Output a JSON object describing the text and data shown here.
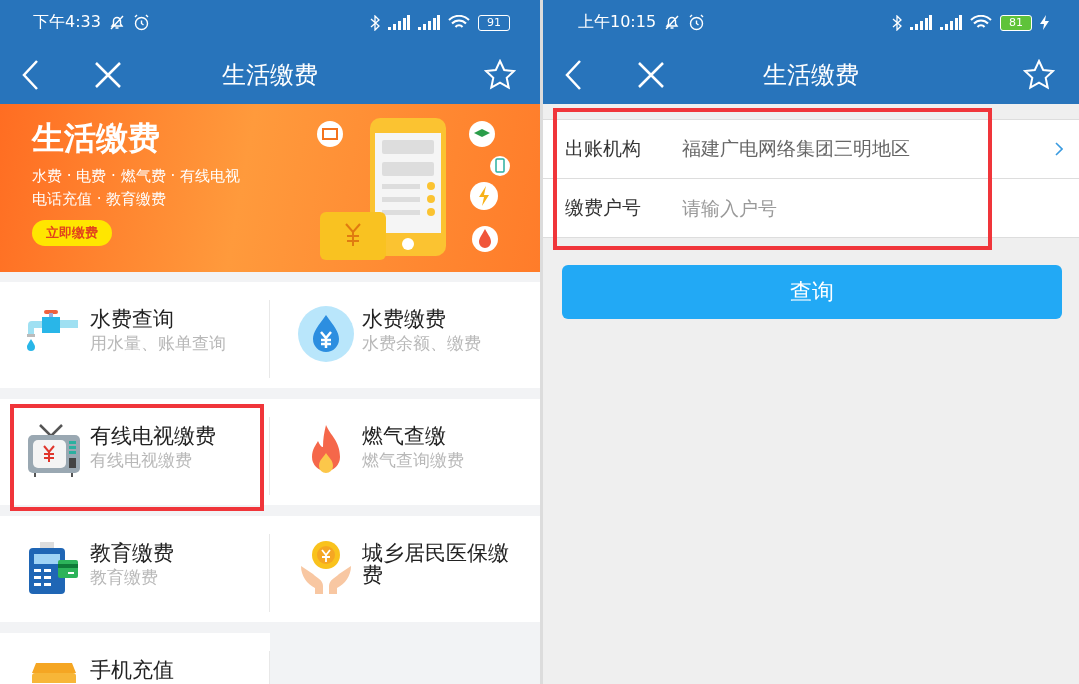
{
  "left_screen": {
    "status_bar": {
      "time": "下午4:33",
      "battery": "91",
      "charging": false
    },
    "nav": {
      "title": "生活缴费"
    },
    "banner": {
      "title": "生活缴费",
      "lines": [
        "水费 · 电费 · 燃气费 · 有线电视",
        "电话充值 · 教育缴费"
      ],
      "button": "立即缴费"
    },
    "tiles": [
      {
        "kind": "faucet",
        "title": "水费查询",
        "subtitle": "用水量、账单查询",
        "highlighted": false
      },
      {
        "kind": "water",
        "title": "水费缴费",
        "subtitle": "水费余额、缴费",
        "highlighted": false
      },
      {
        "kind": "tv",
        "title": "有线电视缴费",
        "subtitle": "有线电视缴费",
        "highlighted": true
      },
      {
        "kind": "flame",
        "title": "燃气查缴",
        "subtitle": "燃气查询缴费",
        "highlighted": false
      },
      {
        "kind": "pos",
        "title": "教育缴费",
        "subtitle": "教育缴费",
        "highlighted": false
      },
      {
        "kind": "hands",
        "title": "城乡居民医保缴费",
        "highlighted": false
      },
      {
        "kind": "topup",
        "title": "手机充值",
        "highlighted": false
      }
    ]
  },
  "right_screen": {
    "status_bar": {
      "time": "上午10:15",
      "battery": "81",
      "charging": true
    },
    "nav": {
      "title": "生活缴费"
    },
    "form": {
      "highlighted": true,
      "rows": [
        {
          "kind": "select",
          "label": "出账机构",
          "value": "福建广电网络集团三明地区"
        },
        {
          "kind": "input",
          "label": "缴费户号",
          "placeholder": "请输入户号"
        }
      ]
    },
    "button": "查询"
  }
}
